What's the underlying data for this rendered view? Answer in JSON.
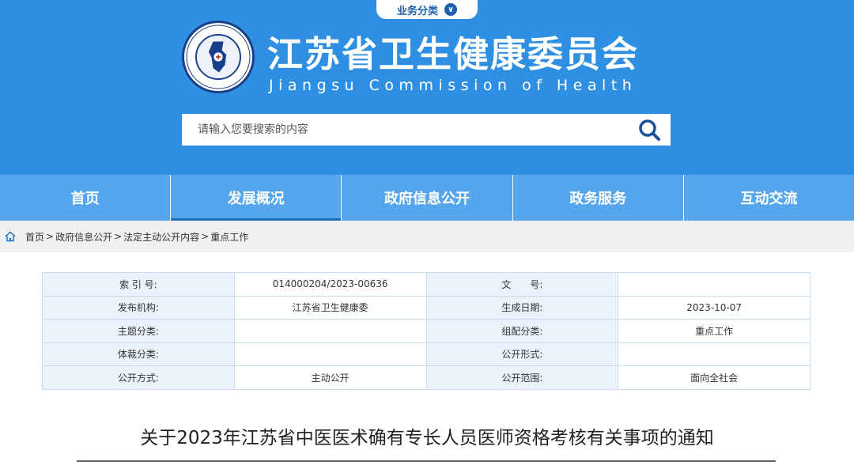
{
  "header": {
    "biz_tab_label": "业务分类",
    "biz_tab_icon": "chevron-down-icon",
    "logo_text_outer": "Jiangsu Commission of Health",
    "title": "江苏省卫生健康委员会",
    "subtitle": "Jiangsu Commission of Health",
    "bg_color": "#2f8fe2"
  },
  "search": {
    "placeholder": "请输入您要搜索的内容",
    "value": "",
    "icon": "search-icon"
  },
  "nav": {
    "items": [
      {
        "label": "首页"
      },
      {
        "label": "发展概况"
      },
      {
        "label": "政府信息公开"
      },
      {
        "label": "政务服务"
      },
      {
        "label": "互动交流"
      }
    ],
    "active_index": 1
  },
  "breadcrumb": {
    "icon": "home-icon",
    "items": [
      "首页",
      "政府信息公开",
      "法定主动公开内容",
      "重点工作"
    ],
    "separator": ">"
  },
  "info": {
    "rows": [
      {
        "k1": "索 引 号:",
        "v1": "014000204/2023-00636",
        "k2": "文　　号:",
        "v2": ""
      },
      {
        "k1": "发布机构:",
        "v1": "江苏省卫生健康委",
        "k2": "生成日期:",
        "v2": "2023-10-07"
      },
      {
        "k1": "主题分类:",
        "v1": "",
        "k2": "组配分类:",
        "v2": "重点工作"
      },
      {
        "k1": "体裁分类:",
        "v1": "",
        "k2": "公开形式:",
        "v2": ""
      },
      {
        "k1": "公开方式:",
        "v1": "主动公开",
        "k2": "公开范围:",
        "v2": "面向全社会"
      }
    ]
  },
  "document": {
    "title": "关于2023年江苏省中医医术确有专长人员医师资格考核有关事项的通知"
  }
}
